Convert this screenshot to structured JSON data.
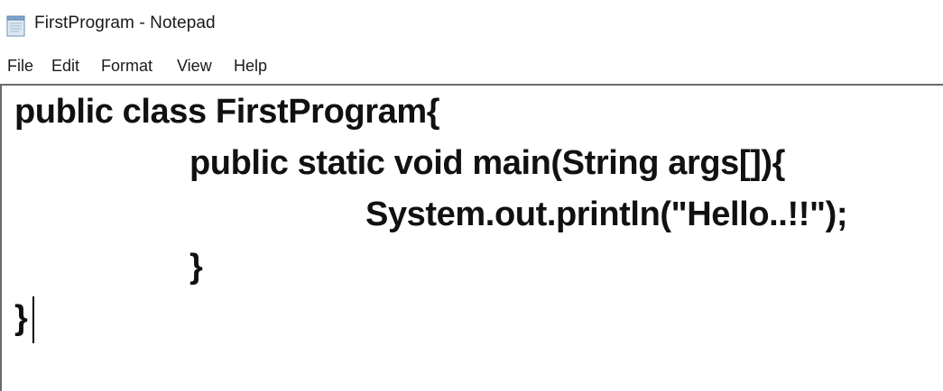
{
  "window": {
    "title": "FirstProgram - Notepad",
    "icon": "notepad-icon"
  },
  "menu": {
    "items": [
      {
        "label": "File"
      },
      {
        "label": "Edit"
      },
      {
        "label": "Format"
      },
      {
        "label": "View"
      },
      {
        "label": "Help"
      }
    ]
  },
  "editor": {
    "lines": [
      "public class FirstProgram{",
      "public static void main(String args[]){",
      "System.out.println(\"Hello..!!\");",
      "}",
      "}"
    ]
  },
  "colors": {
    "text": "#111111",
    "border": "#6b6b6b",
    "background": "#ffffff"
  }
}
